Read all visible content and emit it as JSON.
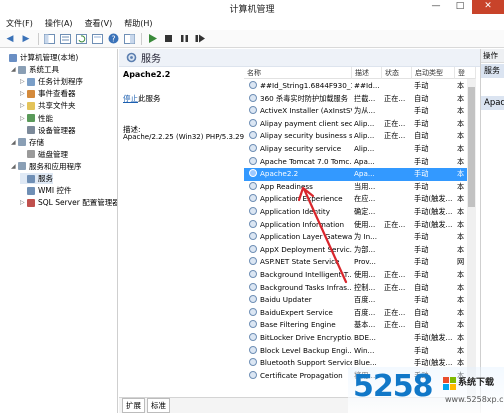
{
  "window": {
    "title": "计算机管理",
    "minimize": "—",
    "maximize": "□",
    "close": "✕"
  },
  "menu": [
    "文件(F)",
    "操作(A)",
    "查看(V)",
    "帮助(H)"
  ],
  "tree": [
    {
      "label": "计算机管理(本地)",
      "indent": 0,
      "exp": "",
      "icon": "#6a8fc4",
      "name": "tree-computer-management"
    },
    {
      "label": "系统工具",
      "indent": 1,
      "exp": "◢",
      "icon": "#8a9fb5",
      "name": "tree-system-tools"
    },
    {
      "label": "任务计划程序",
      "indent": 2,
      "exp": "▷",
      "icon": "#7b9fc8",
      "name": "tree-task-scheduler"
    },
    {
      "label": "事件查看器",
      "indent": 2,
      "exp": "▷",
      "icon": "#d48a3c",
      "name": "tree-event-viewer"
    },
    {
      "label": "共享文件夹",
      "indent": 2,
      "exp": "▷",
      "icon": "#e3c35a",
      "name": "tree-shared-folders"
    },
    {
      "label": "性能",
      "indent": 2,
      "exp": "▷",
      "icon": "#5a9a5a",
      "name": "tree-performance"
    },
    {
      "label": "设备管理器",
      "indent": 2,
      "exp": "",
      "icon": "#7c8a9a",
      "name": "tree-device-manager"
    },
    {
      "label": "存储",
      "indent": 1,
      "exp": "◢",
      "icon": "#8a9fb5",
      "name": "tree-storage"
    },
    {
      "label": "磁盘管理",
      "indent": 2,
      "exp": "",
      "icon": "#9a9a9a",
      "name": "tree-disk-management"
    },
    {
      "label": "服务和应用程序",
      "indent": 1,
      "exp": "◢",
      "icon": "#8a9fb5",
      "name": "tree-services-apps"
    },
    {
      "label": "服务",
      "indent": 2,
      "exp": "",
      "icon": "#6f8fb5",
      "name": "tree-services",
      "selected": true
    },
    {
      "label": "WMI 控件",
      "indent": 2,
      "exp": "",
      "icon": "#6f8fb5",
      "name": "tree-wmi-control"
    },
    {
      "label": "SQL Server 配置管理器",
      "indent": 2,
      "exp": "▷",
      "icon": "#c0504d",
      "name": "tree-sql-server-config"
    }
  ],
  "pane": {
    "title": "服务"
  },
  "detail": {
    "service_name": "Apache2.2",
    "stop_link": "停止",
    "stop_suffix": "此服务",
    "desc_label": "描述:",
    "desc_text": "Apache/2.2.25 (Win32) PHP/5.3.29"
  },
  "columns": [
    "名称",
    "描述",
    "状态",
    "启动类型",
    "登"
  ],
  "rows": [
    [
      "##Id_String1.6844F930_1...",
      "##Id...",
      "",
      "手动",
      "本"
    ],
    [
      "360 杀毒实时防护加载服务",
      "拦截...",
      "正在...",
      "自动",
      "本"
    ],
    [
      "ActiveX Installer (AxInstSV)",
      "为从...",
      "",
      "手动",
      "本"
    ],
    [
      "Alipay payment client sec...",
      "Alip...",
      "正在...",
      "手动",
      "本"
    ],
    [
      "Alipay security business s...",
      "Alip...",
      "正在...",
      "自动",
      "本"
    ],
    [
      "Alipay security service",
      "Alip...",
      "",
      "手动",
      "本"
    ],
    [
      "Apache Tomcat 7.0 Tomc...",
      "Apa...",
      "",
      "手动",
      "本"
    ],
    [
      "Apache2.2",
      "Apa...",
      "",
      "手动",
      "本"
    ],
    [
      "App Readiness",
      "当用...",
      "",
      "手动",
      "本"
    ],
    [
      "Application Experience",
      "在应...",
      "",
      "手动(触发...",
      "本"
    ],
    [
      "Application Identity",
      "确定...",
      "",
      "手动(触发...",
      "本"
    ],
    [
      "Application Information",
      "使用...",
      "正在...",
      "手动(触发...",
      "本"
    ],
    [
      "Application Layer Gatewa...",
      "为 In...",
      "",
      "手动",
      "本"
    ],
    [
      "AppX Deployment Servic...",
      "为部...",
      "",
      "手动",
      "本"
    ],
    [
      "ASP.NET State Service",
      "Prov...",
      "",
      "手动",
      "网"
    ],
    [
      "Background Intelligent T...",
      "使用...",
      "正在...",
      "手动",
      "本"
    ],
    [
      "Background Tasks Infras...",
      "控制...",
      "正在...",
      "自动",
      "本"
    ],
    [
      "Baidu Updater",
      "百度...",
      "",
      "手动",
      "本"
    ],
    [
      "BaiduExpert Service",
      "百度...",
      "正在...",
      "自动",
      "本"
    ],
    [
      "Base Filtering Engine",
      "基本...",
      "正在...",
      "自动",
      "本"
    ],
    [
      "BitLocker Drive Encryptio...",
      "BDE...",
      "",
      "手动(触发...",
      "本"
    ],
    [
      "Block Level Backup Engi...",
      "Win...",
      "",
      "手动",
      "本"
    ],
    [
      "Bluetooth Support Service",
      "Blue...",
      "",
      "手动(触发...",
      "本"
    ],
    [
      "Certificate Propagation",
      "将用...",
      "",
      "手动",
      "本"
    ]
  ],
  "selected_row": 7,
  "tabs": [
    "扩展",
    "标准"
  ],
  "actions": {
    "header": "操作",
    "item1": "服务",
    "item2": "Apac"
  },
  "watermark": {
    "number": "5258",
    "site": "系统下载",
    "domain": "www.5258xp.com"
  }
}
